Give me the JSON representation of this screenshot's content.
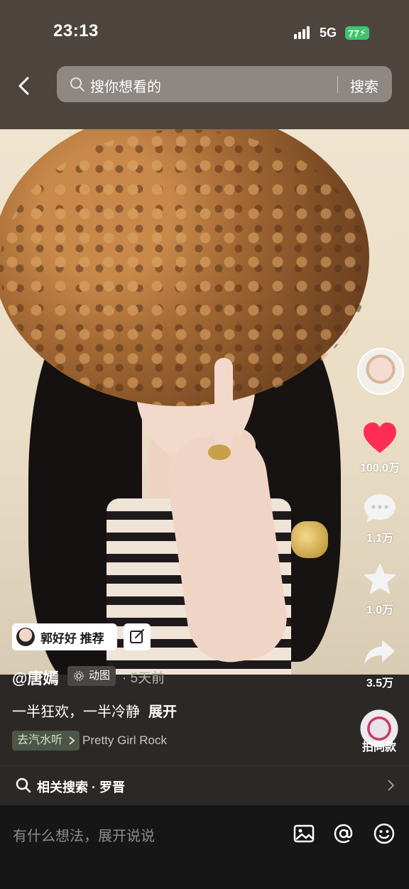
{
  "status": {
    "time": "23:13",
    "network": "5G",
    "battery": "77"
  },
  "search": {
    "placeholder": "搜你想看的",
    "button": "搜索"
  },
  "post": {
    "recommend": "郭好好 推荐",
    "author": "@唐嫣",
    "badge": "动图",
    "time_ago": "· 5天前",
    "description": "一半狂欢，一半冷静",
    "expand": "展开",
    "music_tag": "去汽水听",
    "song": "Pretty Girl Rock"
  },
  "sidebar": {
    "likes": "100.0万",
    "comments": "1.1万",
    "favorites": "1.0万",
    "shares": "3.5万",
    "same_style": "拍同款"
  },
  "related": {
    "text": "相关搜索 · 罗晋"
  },
  "comment": {
    "placeholder": "有什么想法，展开说说"
  },
  "colors": {
    "like": "#ff2d55",
    "battery": "#3ec46d"
  }
}
